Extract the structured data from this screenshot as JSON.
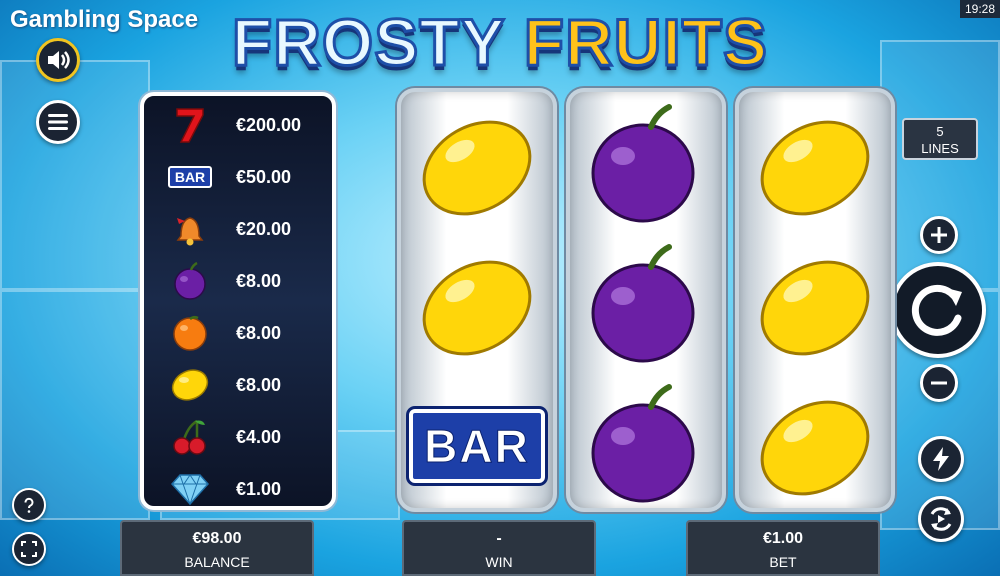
{
  "brand": "Gambling Space",
  "clock": "19:28",
  "title": {
    "part1": "FROSTY",
    "part2": "FRUITS"
  },
  "lines": {
    "value": "5",
    "label": "LINES"
  },
  "paytable": [
    {
      "symbol": "seven-icon",
      "value": "€200.00"
    },
    {
      "symbol": "bar-icon",
      "label": "BAR",
      "value": "€50.00"
    },
    {
      "symbol": "bell-icon",
      "value": "€20.00"
    },
    {
      "symbol": "plum-icon",
      "value": "€8.00"
    },
    {
      "symbol": "orange-icon",
      "value": "€8.00"
    },
    {
      "symbol": "lemon-icon",
      "value": "€8.00"
    },
    {
      "symbol": "cherry-icon",
      "value": "€4.00"
    },
    {
      "symbol": "diamond-icon",
      "value": "€1.00"
    }
  ],
  "reels": [
    [
      "lemon",
      "lemon",
      "bar"
    ],
    [
      "plum",
      "plum",
      "plum"
    ],
    [
      "lemon",
      "lemon",
      "lemon"
    ]
  ],
  "reel_bar_label": "BAR",
  "bottom": {
    "balance": {
      "value": "€98.00",
      "label": "BALANCE"
    },
    "win": {
      "value": "-",
      "label": "WIN"
    },
    "bet": {
      "value": "€1.00",
      "label": "BET"
    }
  },
  "colors": {
    "accent": "#f0c420",
    "reel_border": "#c6d2dc",
    "panel": "#2b3440"
  }
}
